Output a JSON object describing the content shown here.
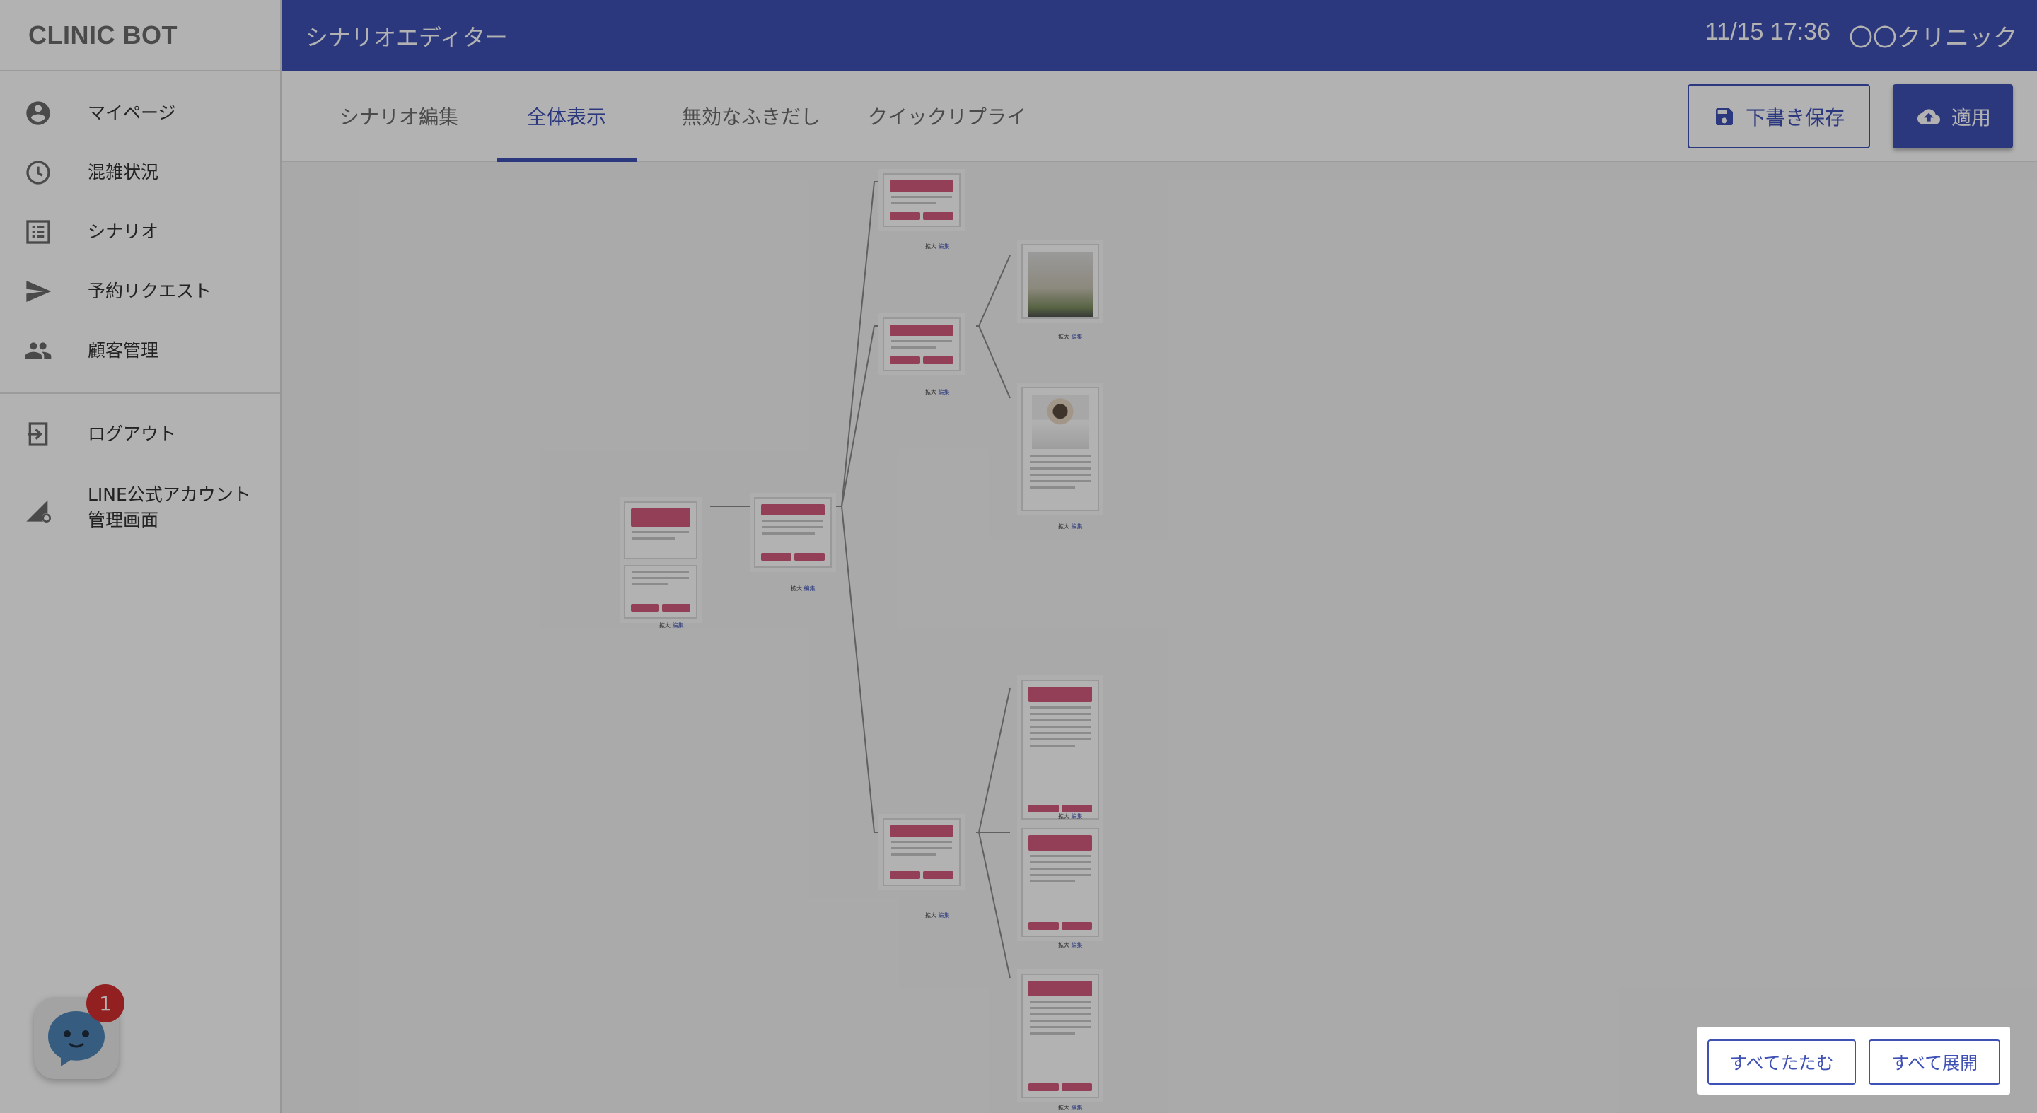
{
  "app": {
    "brand": "CLINIC BOT"
  },
  "header": {
    "title": "シナリオエディター",
    "datetime": "11/15 17:36",
    "clinic": "〇〇クリニック"
  },
  "sidebar": {
    "items": [
      {
        "label": "マイページ",
        "icon": "account-circle-icon"
      },
      {
        "label": "混雑状況",
        "icon": "clock-icon"
      },
      {
        "label": "シナリオ",
        "icon": "list-icon"
      },
      {
        "label": "予約リクエスト",
        "icon": "send-icon"
      },
      {
        "label": "顧客管理",
        "icon": "people-icon"
      }
    ],
    "secondary": [
      {
        "label": "ログアウト",
        "icon": "logout-icon"
      },
      {
        "label_line1": "LINE公式アカウント",
        "label_line2": "管理画面",
        "icon": "admin-settings-icon"
      }
    ]
  },
  "tabs": [
    {
      "label": "シナリオ編集",
      "active": false
    },
    {
      "label": "全体表示",
      "active": true
    },
    {
      "label": "無効なふきだし",
      "active": false
    },
    {
      "label": "クイックリプライ",
      "active": false
    }
  ],
  "toolbar": {
    "draft_label": "下書き保存",
    "apply_label": "適用"
  },
  "tree": {
    "expand_label": "拡大",
    "edit_label": "編集"
  },
  "bottom_panel": {
    "collapse_all": "すべてたたむ",
    "expand_all": "すべて展開"
  },
  "chat_widget": {
    "badge_count": "1"
  },
  "colors": {
    "primary": "#3f51b5",
    "bubble_header": "#d45b7f",
    "badge": "#d32f2f"
  }
}
